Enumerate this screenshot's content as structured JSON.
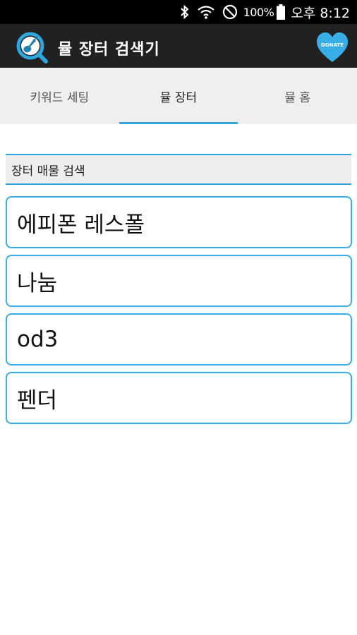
{
  "status": {
    "battery": "100%",
    "time": "오후 8:12",
    "icons": [
      "bluetooth-icon",
      "wifi-icon",
      "do-not-disturb-icon",
      "battery-icon"
    ]
  },
  "app": {
    "title": "뮬 장터 검색기",
    "donate_label": "DONATE",
    "logo_icon": "search-guitar-icon",
    "accent_color": "#2fa6de"
  },
  "tabs": [
    {
      "label": "키워드 세팅",
      "active": false
    },
    {
      "label": "뮬 장터",
      "active": true
    },
    {
      "label": "뮬 홈",
      "active": false
    }
  ],
  "section": {
    "title": "장터 매물 검색"
  },
  "keywords": [
    {
      "label": "에피폰 레스폴"
    },
    {
      "label": "나눔"
    },
    {
      "label": "od3"
    },
    {
      "label": "펜더"
    }
  ]
}
